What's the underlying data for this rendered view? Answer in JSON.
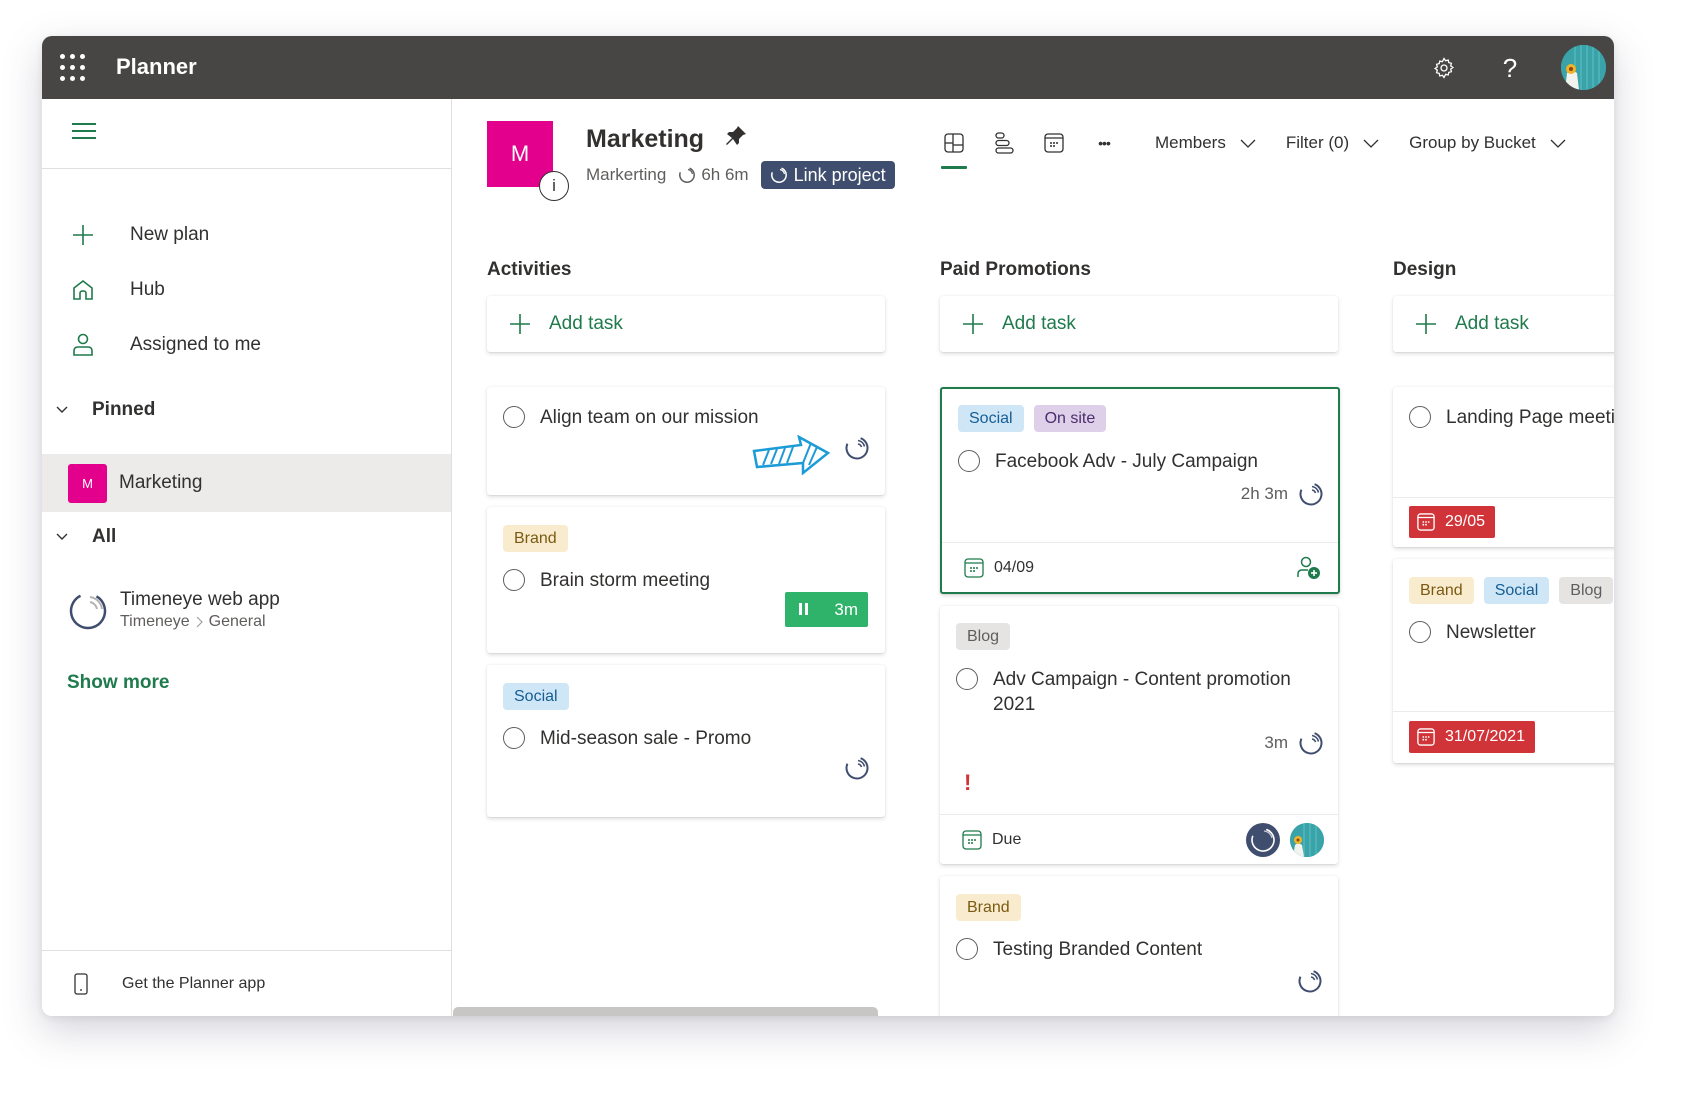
{
  "topbar": {
    "app_title": "Planner",
    "icons": [
      "waffle-icon",
      "settings-gear-icon",
      "help-question-icon",
      "user-avatar"
    ],
    "help_glyph": "?"
  },
  "sidebar": {
    "nav": [
      {
        "label": "New plan",
        "icon": "plus-icon"
      },
      {
        "label": "Hub",
        "icon": "home-icon"
      },
      {
        "label": "Assigned to me",
        "icon": "person-icon"
      }
    ],
    "pinned": {
      "header": "Pinned",
      "items": [
        {
          "badge": "M",
          "label": "Marketing",
          "color": "#e3008c"
        }
      ]
    },
    "all": {
      "header": "All",
      "items": [
        {
          "name": "Timeneye web app",
          "path_1": "Timeneye",
          "path_2": "General"
        }
      ]
    },
    "show_more": "Show more",
    "footer": "Get the Planner app"
  },
  "plan": {
    "logo_letter": "M",
    "info_glyph": "i",
    "title": "Marketing",
    "group": "Markerting",
    "tracked_time": "6h 6m",
    "link_project": "Link project"
  },
  "toolbar": {
    "views": [
      "board-view-icon",
      "schedule-list-icon",
      "calendar-icon",
      "more-options-icon"
    ],
    "more_glyph": "•••",
    "members": "Members",
    "filter": "Filter (0)",
    "group_by": "Group by Bucket"
  },
  "buckets": [
    {
      "title": "Activities",
      "add_task": "Add task",
      "cards": [
        {
          "title": "Align team on our mission",
          "tags": []
        },
        {
          "title": "Brain storm meeting",
          "tags": [
            "Brand"
          ],
          "running_timer": "3m"
        },
        {
          "title": "Mid-season sale - Promo",
          "tags": [
            "Social"
          ]
        }
      ]
    },
    {
      "title": "Paid Promotions",
      "add_task": "Add task",
      "cards": [
        {
          "title": "Facebook Adv - July Campaign",
          "tags": [
            "Social",
            "On site"
          ],
          "time": "2h 3m",
          "due": "04/09"
        },
        {
          "title": "Adv Campaign - Content promotion 2021",
          "tags": [
            "Blog"
          ],
          "time": "3m",
          "priority": "!",
          "due": "Due"
        },
        {
          "title": "Testing Branded Content",
          "tags": [
            "Brand"
          ]
        }
      ]
    },
    {
      "title": "Design",
      "add_task": "Add task",
      "cards": [
        {
          "title": "Landing Page meeting",
          "tags": [],
          "due": "29/05"
        },
        {
          "title": "Newsletter",
          "tags": [
            "Brand",
            "Social",
            "Blog"
          ],
          "due": "31/07/2021"
        }
      ]
    }
  ],
  "colors": {
    "accent": "#1f7a4c",
    "plan": "#e3008c",
    "topbar": "#484644",
    "link_project": "#3f4e6e",
    "overdue": "#d13438",
    "running": "#2fb36a",
    "hint_arrow": "#1b9bd7"
  }
}
